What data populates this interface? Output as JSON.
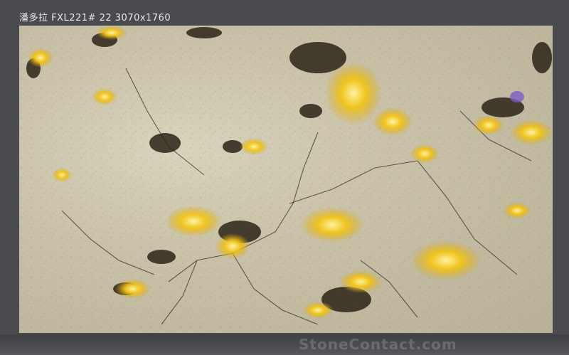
{
  "caption": "潘多拉 FXL221# 22 3070x1760",
  "watermark": "StoneContact.com",
  "colors": {
    "background": "#4a4b4f",
    "stone_base": "#cfc8ae",
    "gold_vein": "#f2c417",
    "dark_vein": "#2b2418",
    "purple_spot": "#7b5cc4"
  }
}
